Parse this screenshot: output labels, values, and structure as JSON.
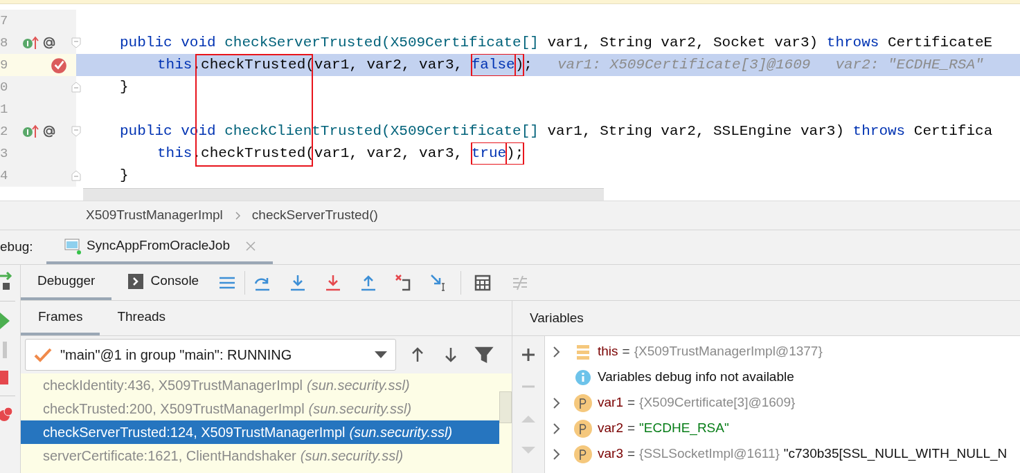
{
  "editor": {
    "lines": [
      {
        "number": "7",
        "selected": false,
        "breakpoint": false,
        "implements_marker": false,
        "annotation_marker": false,
        "fold_start": false,
        "fold_end": false
      },
      {
        "number": "8",
        "selected": false,
        "breakpoint": false,
        "implements_marker": true,
        "annotation_marker": true,
        "fold_start": true,
        "fold_end": false,
        "tokens": [
          {
            "kind": "keyword",
            "text": "public"
          },
          {
            "kind": "keyword",
            "text": "void"
          },
          {
            "kind": "method",
            "text": "checkServerTrusted(X509Certificate[]",
            "boxed": false
          },
          {
            "kind": "plain",
            "text": "var1, String var2, Socket var3)",
            "boxed": false
          },
          {
            "kind": "keyword",
            "text": "throws"
          },
          {
            "kind": "plain",
            "text": "CertificateE",
            "boxed": false
          }
        ],
        "children": [
          {
            "number": "9",
            "selected": true,
            "breakpoint": true,
            "implements_marker": false,
            "annotation_marker": false,
            "fold_start": false,
            "fold_end": false,
            "tokens": [
              {
                "kind": "keyword",
                "text": "this",
                "boxed": false,
                "joined": true
              },
              {
                "kind": "plain",
                "text": ".checkTrusted(var1, var2, var3,",
                "boxed": false
              },
              {
                "kind": "keyword",
                "text": "false",
                "boxed": true,
                "joined": true
              },
              {
                "kind": "plain",
                "text": ")",
                "boxed": true,
                "joined": true
              },
              {
                "kind": "plain",
                "text": ";",
                "boxed": false
              }
            ],
            "hints": [
              "var1: X509Certificate[3]@1609",
              "var2: \"ECDHE_RSA\""
            ]
          }
        ]
      },
      {
        "number": "0",
        "selected": false,
        "breakpoint": false,
        "implements_marker": false,
        "annotation_marker": false,
        "fold_start": false,
        "fold_end": true,
        "tokens": [
          {
            "kind": "plain",
            "text": "}",
            "boxed": false
          }
        ]
      },
      {
        "number": "1",
        "selected": false,
        "breakpoint": false,
        "implements_marker": false,
        "annotation_marker": false,
        "fold_start": false,
        "fold_end": false
      },
      {
        "number": "2",
        "selected": false,
        "breakpoint": false,
        "implements_marker": true,
        "annotation_marker": true,
        "fold_start": true,
        "fold_end": false,
        "tokens": [
          {
            "kind": "keyword",
            "text": "public"
          },
          {
            "kind": "keyword",
            "text": "void"
          },
          {
            "kind": "method",
            "text": "checkClientTrusted(X509Certificate[]",
            "boxed": false
          },
          {
            "kind": "plain",
            "text": "var1, String var2, SSLEngine var3)",
            "boxed": false
          },
          {
            "kind": "keyword",
            "text": "throws"
          },
          {
            "kind": "plain",
            "text": "Certifica",
            "boxed": false
          }
        ],
        "children": [
          {
            "number": "3",
            "selected": false,
            "breakpoint": false,
            "implements_marker": false,
            "annotation_marker": false,
            "fold_start": false,
            "fold_end": false,
            "tokens": [
              {
                "kind": "keyword",
                "text": "this",
                "boxed": false,
                "joined": true
              },
              {
                "kind": "plain",
                "text": ".checkTrusted(var1, var2, var3,",
                "boxed": false
              },
              {
                "kind": "keyword",
                "text": "true",
                "boxed": true,
                "joined": true
              },
              {
                "kind": "plain",
                "text": ");",
                "boxed": true
              }
            ]
          }
        ]
      },
      {
        "number": "4",
        "selected": false,
        "breakpoint": false,
        "implements_marker": false,
        "annotation_marker": false,
        "fold_start": false,
        "fold_end": true,
        "tokens": [
          {
            "kind": "plain",
            "text": "}",
            "boxed": false
          }
        ]
      }
    ]
  },
  "breadcrumb": [
    "X509TrustManagerImpl",
    "checkServerTrusted()"
  ],
  "debug": {
    "label": "ebug:",
    "session_tab": {
      "title": "SyncAppFromOracleJob",
      "selected": true
    }
  },
  "toolbar": {
    "tabs": [
      {
        "label": "Debugger",
        "kind": "debugger",
        "selected": true
      },
      {
        "label": "Console",
        "kind": "console",
        "selected": false
      }
    ]
  },
  "frames_panel": {
    "tabs": [
      {
        "label": "Frames",
        "selected": true
      },
      {
        "label": "Threads",
        "selected": false
      }
    ],
    "thread": "\"main\"@1 in group \"main\": RUNNING",
    "frames": [
      {
        "location": "checkIdentity:436, X509TrustManagerImpl",
        "package": "(sun.security.ssl)",
        "selected": false
      },
      {
        "location": "checkTrusted:200, X509TrustManagerImpl",
        "package": "(sun.security.ssl)",
        "selected": false
      },
      {
        "location": "checkServerTrusted:124, X509TrustManagerImpl",
        "package": "(sun.security.ssl)",
        "selected": true
      },
      {
        "location": "serverCertificate:1621, ClientHandshaker",
        "package": "(sun.security.ssl)",
        "selected": false
      }
    ]
  },
  "variables": {
    "title": "Variables",
    "items": [
      {
        "kind": "field",
        "name": "this",
        "operator": "=",
        "value": "{X509TrustManagerImpl@1377}",
        "string_value": false
      },
      {
        "kind": "info",
        "text": "Variables debug info not available"
      },
      {
        "kind": "param",
        "name": "var1",
        "operator": "=",
        "value": "{X509Certificate[3]@1609}",
        "string_value": false
      },
      {
        "kind": "param",
        "name": "var2",
        "operator": "=",
        "value": "\"ECDHE_RSA\"",
        "string_value": true
      },
      {
        "kind": "param",
        "name": "var3",
        "operator": "=",
        "value": "{SSLSocketImpl@1611}",
        "string_value": false,
        "extra": "\"c730b35[SSL_NULL_WITH_NULL_N"
      }
    ]
  }
}
